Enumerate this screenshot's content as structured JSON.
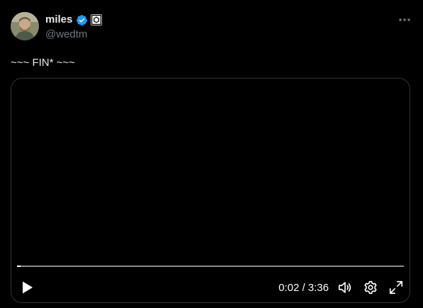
{
  "author": {
    "name": "miles",
    "handle": "@wedtm",
    "verified": true,
    "badge_color": "#1d9bf0"
  },
  "post": {
    "text": "~~~ FIN* ~~~"
  },
  "video": {
    "current_time": "0:02",
    "duration": "3:36",
    "time_text": "0:02 / 3:36",
    "progress_fraction": 0.0093,
    "playing": false
  },
  "icons": {
    "more": "more-horizontal-icon",
    "play": "play-icon",
    "volume": "volume-icon",
    "settings": "gear-icon",
    "fullscreen": "fullscreen-icon"
  }
}
